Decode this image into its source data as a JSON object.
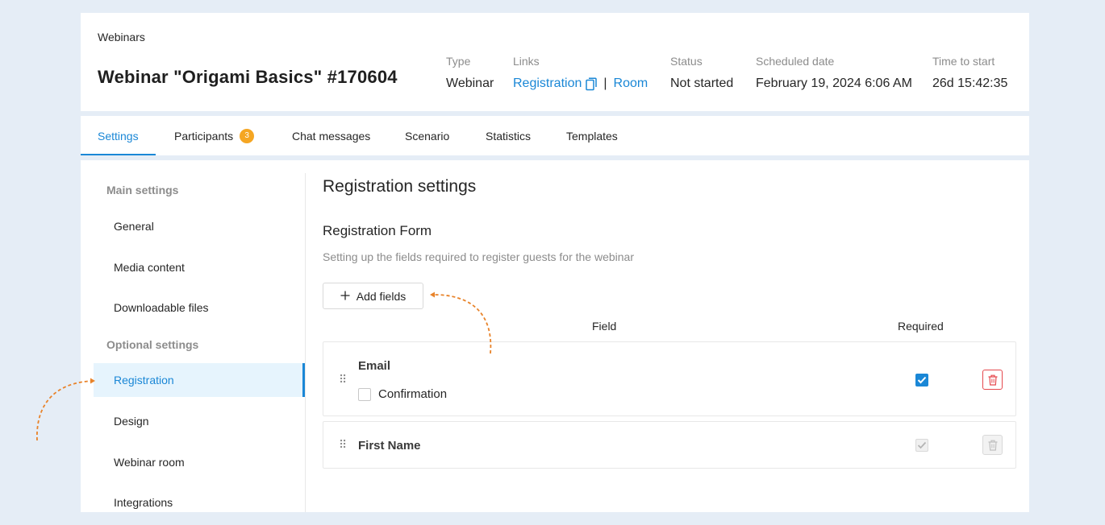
{
  "header": {
    "breadcrumb": "Webinars",
    "title": "Webinar \"Origami Basics\" #170604",
    "meta": {
      "type_label": "Type",
      "type_value": "Webinar",
      "links_label": "Links",
      "registration_link": "Registration",
      "separator": "|",
      "room_link": "Room",
      "status_label": "Status",
      "status_value": "Not started",
      "date_label": "Scheduled date",
      "date_value": "February 19, 2024 6:06 AM",
      "time_label": "Time to start",
      "time_value": "26d 15:42:35"
    }
  },
  "tabs": [
    {
      "label": "Settings",
      "active": true
    },
    {
      "label": "Participants",
      "badge": "3"
    },
    {
      "label": "Chat messages"
    },
    {
      "label": "Scenario"
    },
    {
      "label": "Statistics"
    },
    {
      "label": "Templates"
    }
  ],
  "sidebar": {
    "main_group": "Main settings",
    "main_items": [
      "General",
      "Media content",
      "Downloadable files"
    ],
    "optional_group": "Optional settings",
    "optional_items": [
      "Registration",
      "Design",
      "Webinar room",
      "Integrations"
    ],
    "active_item": "Registration"
  },
  "main": {
    "section_title": "Registration settings",
    "form_title": "Registration Form",
    "form_desc": "Setting up the fields required to register guests for the webinar",
    "add_button": "Add fields",
    "col_field": "Field",
    "col_required": "Required",
    "fields": [
      {
        "name": "Email",
        "confirmation_label": "Confirmation",
        "confirmation_checked": false,
        "required": true,
        "required_disabled": false,
        "deletable": true
      },
      {
        "name": "First Name",
        "required": true,
        "required_disabled": true,
        "deletable": false
      }
    ]
  },
  "colors": {
    "accent": "#1a87d6",
    "badge": "#f5a623",
    "annotation": "#e8832a",
    "delete": "#e5484d",
    "background": "#e5edf6"
  }
}
